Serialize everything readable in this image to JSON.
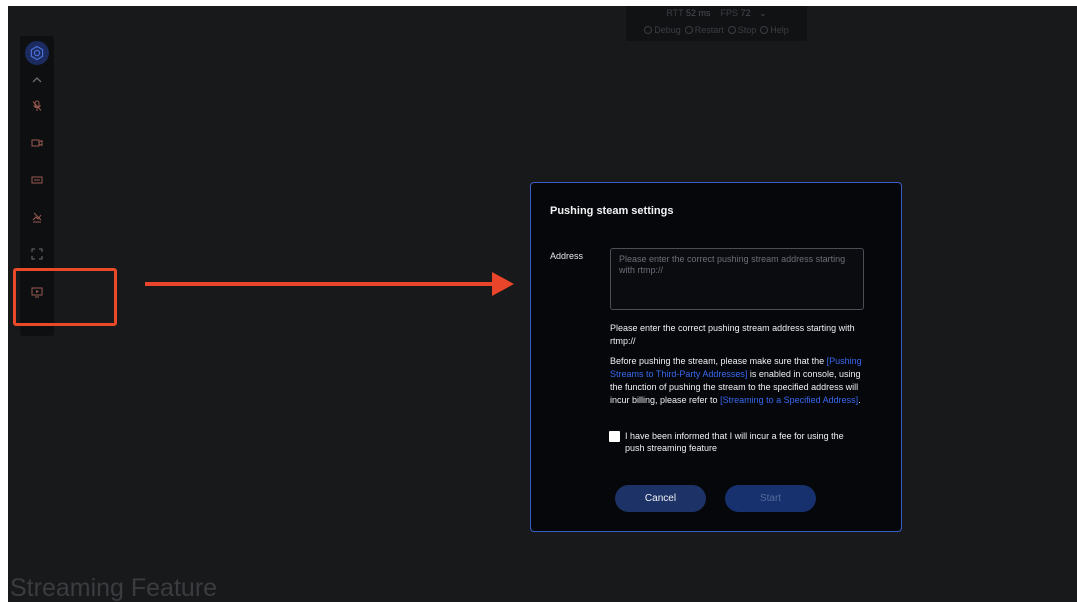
{
  "statsbar": {
    "rtt_label": "RTT",
    "rtt_value": "52 ms",
    "fps_label": "FPS",
    "fps_value": "72",
    "debug_label": "Debug",
    "restart_label": "Restart",
    "stop_label": "Stop",
    "help_label": "Help"
  },
  "toolbar": {
    "icons": [
      "settings-logo-icon",
      "chevron-up-icon",
      "microphone-icon",
      "camera-icon",
      "keyboard-icon",
      "gamepad-off-icon",
      "fullscreen-icon",
      "push-stream-icon"
    ]
  },
  "dialog": {
    "title": "Pushing steam settings",
    "address_label": "Address",
    "address_value": "",
    "address_placeholder": "Please enter the correct pushing stream address starting with rtmp://",
    "hint": "Please enter the correct pushing stream address starting with rtmp://",
    "notice_part1": "Before pushing the stream, please make sure that the ",
    "notice_link1": "[Pushing Streams to Third-Party Addresses]",
    "notice_part2": " is enabled in console, using the function of pushing the stream to the specified address will incur billing, please refer to ",
    "notice_link2": "[Streaming to a Specified Address]",
    "notice_part3": ".",
    "agree_text": "I have been informed that I will incur a fee for using the push streaming feature",
    "agree_checked": false,
    "cancel_label": "Cancel",
    "start_label": "Start"
  },
  "caption": "Streaming Feature",
  "colors": {
    "accent": "#3a5ec5",
    "link": "#3868f0",
    "highlight": "#ea4a2a"
  }
}
